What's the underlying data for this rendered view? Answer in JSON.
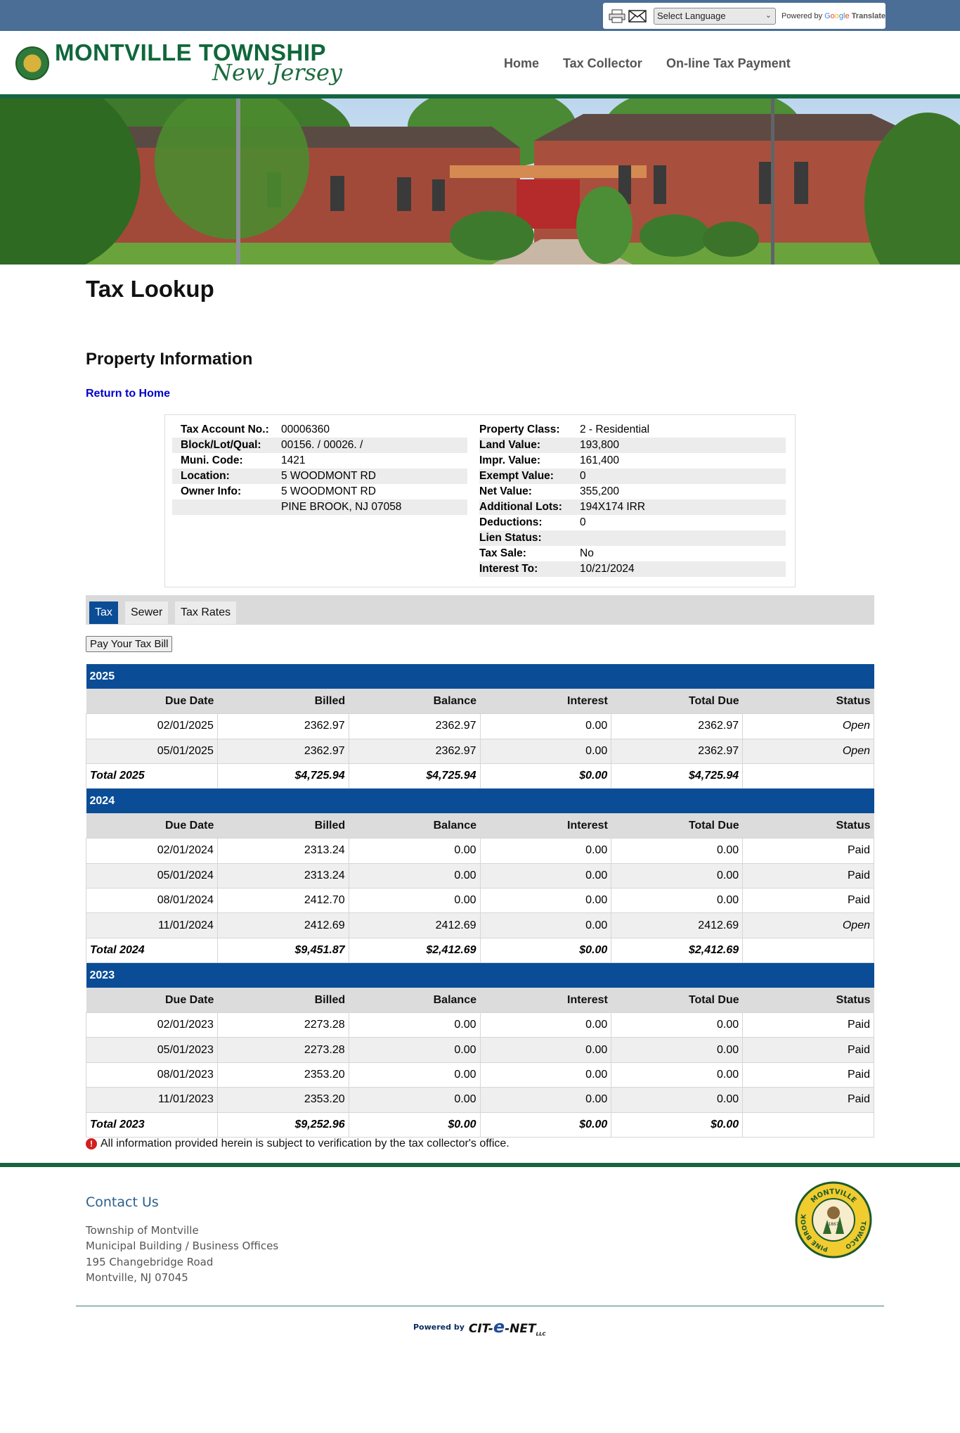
{
  "top_bar": {
    "language_select": "Select Language",
    "powered_by": "Powered by",
    "google": [
      "G",
      "o",
      "o",
      "g",
      "l",
      "e"
    ],
    "translate": "Translate"
  },
  "header": {
    "logo_title": "MONTVILLE TOWNSHIP",
    "logo_subtitle": "New Jersey",
    "nav": [
      "Home",
      "Tax Collector",
      "On-line Tax Payment"
    ]
  },
  "page": {
    "title": "Tax Lookup",
    "section_title": "Property Information",
    "return_link": "Return to Home"
  },
  "property": {
    "left": [
      {
        "label": "Tax Account No.:",
        "value": "00006360"
      },
      {
        "label": "Block/Lot/Qual:",
        "value": "00156. / 00026. /"
      },
      {
        "label": "Muni. Code:",
        "value": "1421"
      },
      {
        "label": "Location:",
        "value": "5 WOODMONT RD"
      },
      {
        "label": "Owner Info:",
        "value": "5 WOODMONT RD"
      },
      {
        "label": "",
        "value": "PINE BROOK, NJ 07058"
      }
    ],
    "right": [
      {
        "label": "Property Class:",
        "value": "2 - Residential"
      },
      {
        "label": "Land Value:",
        "value": "193,800"
      },
      {
        "label": "Impr. Value:",
        "value": "161,400"
      },
      {
        "label": "Exempt Value:",
        "value": "0"
      },
      {
        "label": "Net Value:",
        "value": "355,200"
      },
      {
        "label": "Additional Lots:",
        "value": "194X174 IRR"
      },
      {
        "label": "Deductions:",
        "value": "0"
      },
      {
        "label": "Lien Status:",
        "value": ""
      },
      {
        "label": "Tax Sale:",
        "value": "No"
      },
      {
        "label": "Interest To:",
        "value": "10/21/2024"
      }
    ]
  },
  "tabs": [
    {
      "label": "Tax",
      "active": true
    },
    {
      "label": "Sewer",
      "active": false
    },
    {
      "label": "Tax Rates",
      "active": false
    }
  ],
  "pay_button": "Pay Your Tax Bill",
  "table": {
    "headers": [
      "Due Date",
      "Billed",
      "Balance",
      "Interest",
      "Total Due",
      "Status"
    ],
    "years": [
      {
        "year": "2025",
        "rows": [
          [
            "02/01/2025",
            "2362.97",
            "2362.97",
            "0.00",
            "2362.97",
            "Open"
          ],
          [
            "05/01/2025",
            "2362.97",
            "2362.97",
            "0.00",
            "2362.97",
            "Open"
          ]
        ],
        "total": [
          "Total 2025",
          "$4,725.94",
          "$4,725.94",
          "$0.00",
          "$4,725.94",
          ""
        ]
      },
      {
        "year": "2024",
        "rows": [
          [
            "02/01/2024",
            "2313.24",
            "0.00",
            "0.00",
            "0.00",
            "Paid"
          ],
          [
            "05/01/2024",
            "2313.24",
            "0.00",
            "0.00",
            "0.00",
            "Paid"
          ],
          [
            "08/01/2024",
            "2412.70",
            "0.00",
            "0.00",
            "0.00",
            "Paid"
          ],
          [
            "11/01/2024",
            "2412.69",
            "2412.69",
            "0.00",
            "2412.69",
            "Open"
          ]
        ],
        "total": [
          "Total 2024",
          "$9,451.87",
          "$2,412.69",
          "$0.00",
          "$2,412.69",
          ""
        ]
      },
      {
        "year": "2023",
        "rows": [
          [
            "02/01/2023",
            "2273.28",
            "0.00",
            "0.00",
            "0.00",
            "Paid"
          ],
          [
            "05/01/2023",
            "2273.28",
            "0.00",
            "0.00",
            "0.00",
            "Paid"
          ],
          [
            "08/01/2023",
            "2353.20",
            "0.00",
            "0.00",
            "0.00",
            "Paid"
          ],
          [
            "11/01/2023",
            "2353.20",
            "0.00",
            "0.00",
            "0.00",
            "Paid"
          ]
        ],
        "total": [
          "Total 2023",
          "$9,252.96",
          "$0.00",
          "$0.00",
          "$0.00",
          ""
        ]
      }
    ]
  },
  "note": "All information provided herein is subject to verification by the tax collector's office.",
  "footer": {
    "contact_title": "Contact Us",
    "address": [
      "Township of Montville",
      "Municipal Building / Business Offices",
      "195 Changebridge Road",
      "Montville, NJ 07045"
    ],
    "seal_text_top": "MONTVILLE",
    "seal_text_left": "PINE BROOK",
    "seal_text_right": "TOWACO",
    "seal_year": "1867",
    "powered_by": "Powered by",
    "brand_pre": "CIT-",
    "brand_e": "e",
    "brand_post": "-NET",
    "brand_suffix": "LLC"
  },
  "colors": {
    "top_bar": "#4a6e96",
    "brand_green": "#16653f",
    "table_blue": "#0a4d96",
    "link_blue": "#0000cc"
  }
}
